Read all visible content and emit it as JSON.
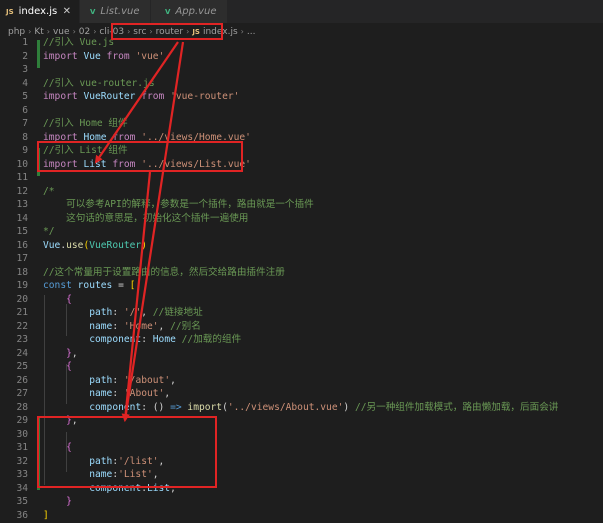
{
  "tabs": [
    {
      "label": "index.js",
      "icon": "JS",
      "type": "js",
      "close": "✕"
    },
    {
      "label": "List.vue",
      "icon": "V",
      "type": "vue"
    },
    {
      "label": "App.vue",
      "icon": "V",
      "type": "vue"
    }
  ],
  "breadcrumb": [
    "php",
    "Kt",
    "vue",
    "02",
    "cli-03",
    "src",
    "router",
    "index.js",
    "..."
  ],
  "breadcrumb_file_icon": "JS",
  "lines": [
    {
      "n": "1",
      "parts": [
        [
          "cmt",
          "//引入 Vue.js"
        ]
      ]
    },
    {
      "n": "2",
      "parts": [
        [
          "kw",
          "import "
        ],
        [
          "var",
          "Vue "
        ],
        [
          "kw",
          "from "
        ],
        [
          "str",
          "'vue'"
        ]
      ]
    },
    {
      "n": "3",
      "parts": []
    },
    {
      "n": "4",
      "parts": [
        [
          "cmt",
          "//引入 vue-router.js"
        ]
      ]
    },
    {
      "n": "5",
      "parts": [
        [
          "kw",
          "import "
        ],
        [
          "var",
          "VueRouter "
        ],
        [
          "kw",
          "from "
        ],
        [
          "str",
          "'vue-router'"
        ]
      ]
    },
    {
      "n": "6",
      "parts": []
    },
    {
      "n": "7",
      "parts": [
        [
          "cmt",
          "//引入 Home 组件"
        ]
      ]
    },
    {
      "n": "8",
      "parts": [
        [
          "kw",
          "import "
        ],
        [
          "var",
          "Home "
        ],
        [
          "kw",
          "from "
        ],
        [
          "str",
          "'../views/Home.vue'"
        ]
      ]
    },
    {
      "n": "9",
      "parts": [
        [
          "cmt",
          "//引入 List 组件"
        ]
      ]
    },
    {
      "n": "10",
      "parts": [
        [
          "kw",
          "import "
        ],
        [
          "var",
          "List "
        ],
        [
          "kw",
          "from "
        ],
        [
          "str",
          "'../views/List.vue'"
        ]
      ]
    },
    {
      "n": "11",
      "parts": []
    },
    {
      "n": "12",
      "parts": [
        [
          "cmt",
          "/*"
        ]
      ]
    },
    {
      "n": "13",
      "parts": [
        [
          "cmt",
          "    可以参考API的解释，参数是一个插件，路由就是一个插件"
        ]
      ]
    },
    {
      "n": "14",
      "parts": [
        [
          "cmt",
          "    这句话的意思是，初始化这个插件一遍使用"
        ]
      ]
    },
    {
      "n": "15",
      "parts": [
        [
          "cmt",
          "*/"
        ]
      ]
    },
    {
      "n": "16",
      "parts": [
        [
          "var",
          "Vue"
        ],
        [
          "punc",
          "."
        ],
        [
          "fn",
          "use"
        ],
        [
          "br1",
          "("
        ],
        [
          "cls",
          "VueRouter"
        ],
        [
          "br1",
          ")"
        ]
      ]
    },
    {
      "n": "17",
      "parts": []
    },
    {
      "n": "18",
      "parts": [
        [
          "cmt",
          "//这个常量用于设置路由的信息，然后交给路由插件注册"
        ]
      ]
    },
    {
      "n": "19",
      "parts": [
        [
          "kw2",
          "const "
        ],
        [
          "var",
          "routes "
        ],
        [
          "punc",
          "= "
        ],
        [
          "br1",
          "["
        ]
      ]
    },
    {
      "n": "20",
      "parts": [
        [
          "punc",
          "    "
        ],
        [
          "br2",
          "{"
        ]
      ]
    },
    {
      "n": "21",
      "parts": [
        [
          "punc",
          "        "
        ],
        [
          "var",
          "path"
        ],
        [
          "punc",
          ": "
        ],
        [
          "str",
          "'/'"
        ],
        [
          "punc",
          ", "
        ],
        [
          "cmt",
          "//链接地址"
        ]
      ]
    },
    {
      "n": "22",
      "parts": [
        [
          "punc",
          "        "
        ],
        [
          "var",
          "name"
        ],
        [
          "punc",
          ": "
        ],
        [
          "str",
          "'Home'"
        ],
        [
          "punc",
          ", "
        ],
        [
          "cmt",
          "//别名"
        ]
      ]
    },
    {
      "n": "23",
      "parts": [
        [
          "punc",
          "        "
        ],
        [
          "var",
          "component"
        ],
        [
          "punc",
          ": "
        ],
        [
          "var",
          "Home "
        ],
        [
          "cmt",
          "//加载的组件"
        ]
      ]
    },
    {
      "n": "24",
      "parts": [
        [
          "punc",
          "    "
        ],
        [
          "br2",
          "}"
        ],
        [
          "punc",
          ","
        ]
      ]
    },
    {
      "n": "25",
      "parts": [
        [
          "punc",
          "    "
        ],
        [
          "br2",
          "{"
        ]
      ]
    },
    {
      "n": "26",
      "parts": [
        [
          "punc",
          "        "
        ],
        [
          "var",
          "path"
        ],
        [
          "punc",
          ": "
        ],
        [
          "str",
          "'/about'"
        ],
        [
          "punc",
          ","
        ]
      ]
    },
    {
      "n": "27",
      "parts": [
        [
          "punc",
          "        "
        ],
        [
          "var",
          "name"
        ],
        [
          "punc",
          ": "
        ],
        [
          "str",
          "'About'"
        ],
        [
          "punc",
          ","
        ]
      ]
    },
    {
      "n": "28",
      "parts": [
        [
          "punc",
          "        "
        ],
        [
          "var",
          "component"
        ],
        [
          "punc",
          ": () "
        ],
        [
          "kw2",
          "=> "
        ],
        [
          "fn",
          "import"
        ],
        [
          "punc",
          "("
        ],
        [
          "str",
          "'../views/About.vue'"
        ],
        [
          "punc",
          ") "
        ],
        [
          "cmt",
          "//另一种组件加载模式，路由懒加载，后面会讲"
        ]
      ]
    },
    {
      "n": "29",
      "parts": [
        [
          "punc",
          "    "
        ],
        [
          "br2",
          "}"
        ],
        [
          "punc",
          ","
        ]
      ]
    },
    {
      "n": "30",
      "parts": []
    },
    {
      "n": "31",
      "parts": [
        [
          "punc",
          "    "
        ],
        [
          "br2",
          "{"
        ]
      ]
    },
    {
      "n": "32",
      "parts": [
        [
          "punc",
          "        "
        ],
        [
          "var",
          "path"
        ],
        [
          "punc",
          ":"
        ],
        [
          "str",
          "'/list'"
        ],
        [
          "punc",
          ","
        ]
      ]
    },
    {
      "n": "33",
      "parts": [
        [
          "punc",
          "        "
        ],
        [
          "var",
          "name"
        ],
        [
          "punc",
          ":"
        ],
        [
          "str",
          "'List'"
        ],
        [
          "punc",
          ","
        ]
      ]
    },
    {
      "n": "34",
      "parts": [
        [
          "punc",
          "        "
        ],
        [
          "var",
          "component"
        ],
        [
          "punc",
          ":"
        ],
        [
          "var",
          "List"
        ],
        [
          "punc",
          ","
        ]
      ]
    },
    {
      "n": "35",
      "parts": [
        [
          "punc",
          "    "
        ],
        [
          "br2",
          "}"
        ]
      ]
    },
    {
      "n": "36",
      "parts": [
        [
          "br1",
          "]"
        ]
      ]
    }
  ],
  "colors": {
    "editor_bg": "#1e1e1e",
    "annotation_red": "#e02424",
    "comment": "#6a9955",
    "keyword": "#c586c0",
    "string": "#ce9178"
  }
}
